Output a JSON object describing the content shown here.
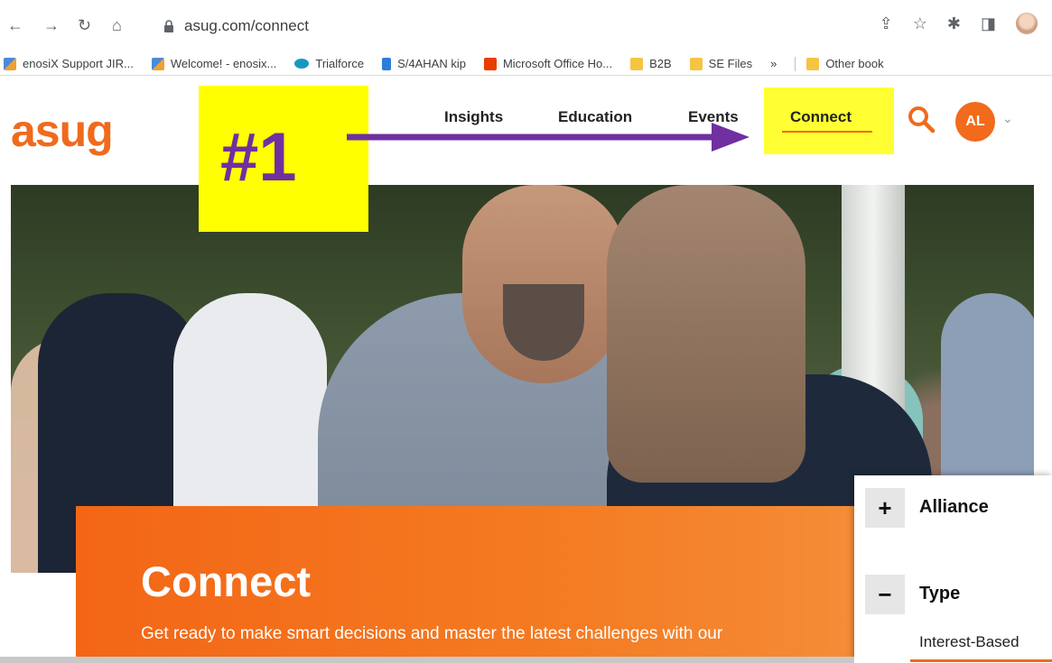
{
  "browser": {
    "url": "asug.com/connect",
    "bookmarks": [
      {
        "label": "enosiX Support JIR..."
      },
      {
        "label": "Welcome! - enosix..."
      },
      {
        "label": "Trialforce"
      },
      {
        "label": "S/4AHAN kip"
      },
      {
        "label": "Microsoft Office Ho..."
      },
      {
        "label": "B2B"
      },
      {
        "label": "SE Files"
      }
    ],
    "overflow_label": "»",
    "other_bookmarks_label": "Other book"
  },
  "site": {
    "logo": "asug",
    "nav": {
      "insights": "Insights",
      "education": "Education",
      "events": "Events",
      "connect": "Connect"
    },
    "avatar_initials": "AL",
    "accent_color": "#f06a1d"
  },
  "banner": {
    "title": "Connect",
    "subtitle": "Get ready to make smart decisions and master the latest challenges with our"
  },
  "annotation": {
    "label": "#1",
    "highlight_color": "#ffff00",
    "text_color": "#7030a0"
  },
  "filter": {
    "alliance_label": "Alliance",
    "alliance_toggle": "+",
    "type_label": "Type",
    "type_toggle": "−",
    "option": "Interest-Based"
  }
}
